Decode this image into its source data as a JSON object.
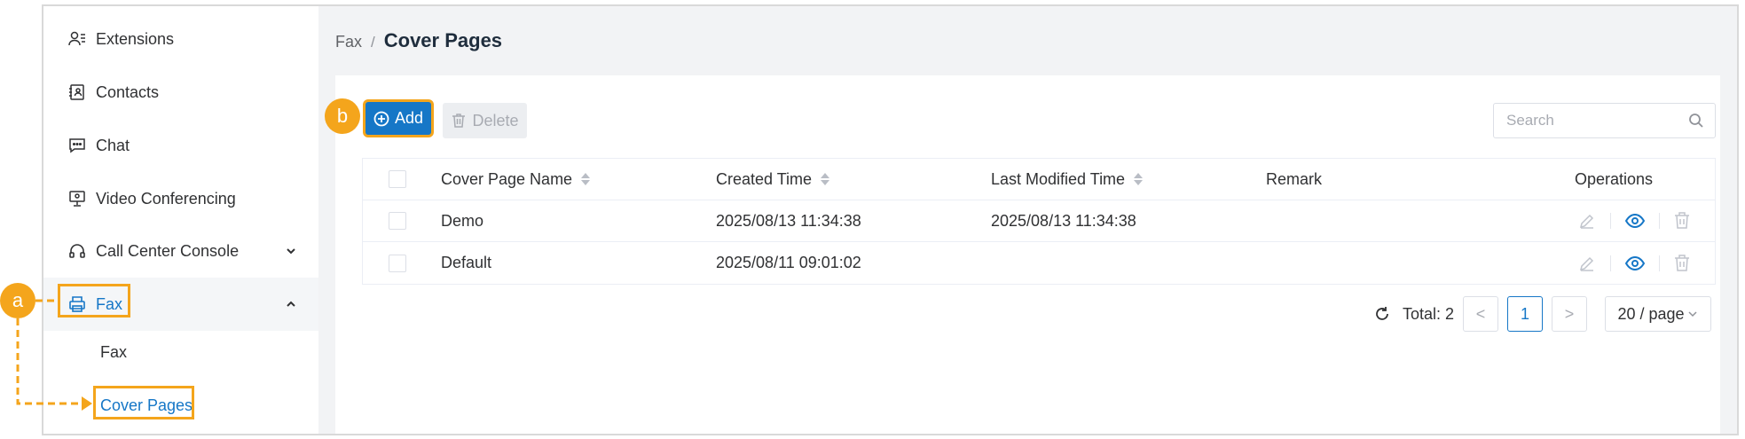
{
  "sidebar": {
    "items": [
      {
        "label": "Extensions",
        "icon": "user-list-icon"
      },
      {
        "label": "Contacts",
        "icon": "contacts-book-icon"
      },
      {
        "label": "Chat",
        "icon": "chat-bubble-icon"
      },
      {
        "label": "Video Conferencing",
        "icon": "monitor-icon"
      },
      {
        "label": "Call Center Console",
        "icon": "headset-icon"
      },
      {
        "label": "Fax",
        "icon": "printer-icon"
      }
    ],
    "subitems": [
      {
        "label": "Fax"
      },
      {
        "label": "Cover Pages"
      }
    ]
  },
  "breadcrumb": {
    "parent": "Fax",
    "separator": "/",
    "title": "Cover Pages"
  },
  "toolbar": {
    "add_label": "Add",
    "delete_label": "Delete",
    "search_placeholder": "Search"
  },
  "table": {
    "columns": [
      "Cover Page Name",
      "Created Time",
      "Last Modified Time",
      "Remark",
      "Operations"
    ],
    "rows": [
      {
        "name": "Demo",
        "created": "2025/08/13 11:34:38",
        "modified": "2025/08/13 11:34:38",
        "remark": ""
      },
      {
        "name": "Default",
        "created": "2025/08/11 09:01:02",
        "modified": "",
        "remark": ""
      }
    ]
  },
  "pagination": {
    "total_label": "Total: 2",
    "prev": "<",
    "next": ">",
    "current_page": "1",
    "page_size": "20 / page"
  },
  "annotations": {
    "a": "a",
    "b": "b"
  },
  "colors": {
    "accent": "#1677c7",
    "highlight": "#f4a51c"
  }
}
